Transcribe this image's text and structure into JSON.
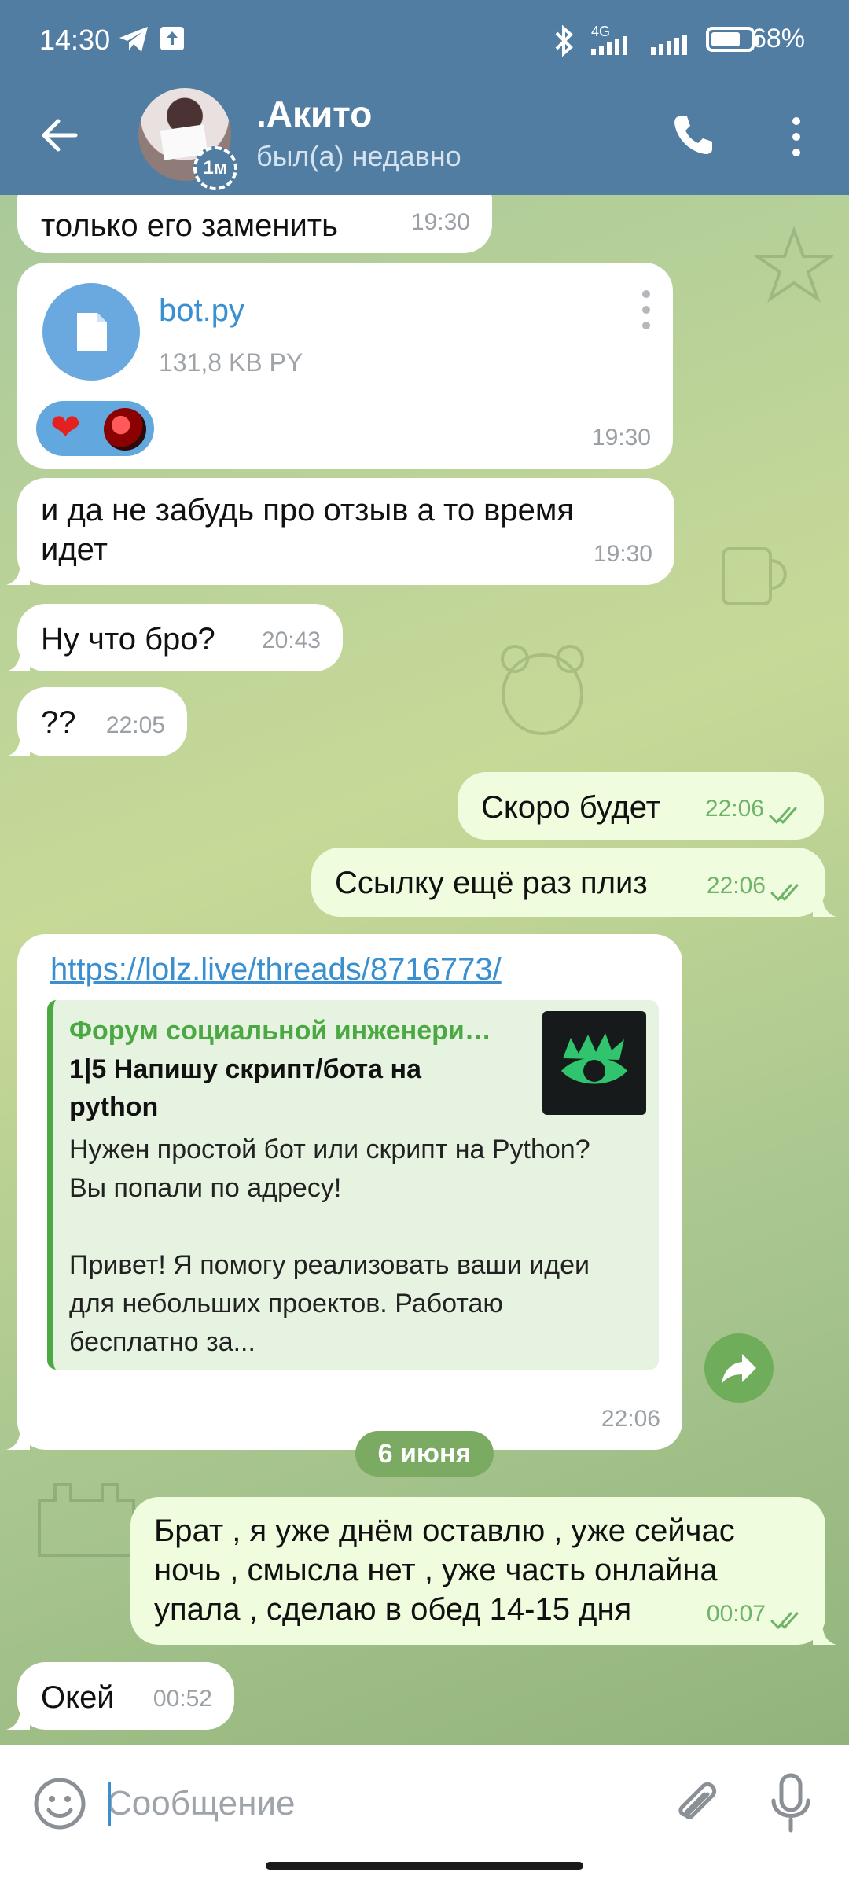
{
  "status_bar": {
    "time": "14:30",
    "network": "4G",
    "battery": "68%"
  },
  "header": {
    "title": ".Акито",
    "status": "был(а) недавно",
    "story_badge": "1м"
  },
  "messages": [
    {
      "dir": "in",
      "text": "только его заменить",
      "time": "19:30"
    },
    {
      "dir": "in",
      "type": "file",
      "file_name": "bot.py",
      "file_size": "131,8 KB PY",
      "reaction": "❤",
      "time": "19:30"
    },
    {
      "dir": "in",
      "text": "и да не забудь про отзыв а то время\nидет",
      "time": "19:30"
    },
    {
      "dir": "in",
      "text": "Ну что бро?",
      "time": "20:43"
    },
    {
      "dir": "in",
      "text": "??",
      "time": "22:05"
    },
    {
      "dir": "out",
      "text": "Скоро будет",
      "time": "22:06"
    },
    {
      "dir": "out",
      "text": "Ссылку ещё раз плиз",
      "time": "22:06"
    },
    {
      "dir": "in",
      "type": "link",
      "url": "https://lolz.live/threads/8716773/",
      "preview_site": "Форум социальной инженери…",
      "preview_title": "1|5 Напишу скрипт/бота на python",
      "preview_desc": "Нужен простой бот или скрипт на Python? Вы попали по адресу!\n\nПривет! Я помогу реализовать ваши идеи для небольших проектов. Работаю бесплатно за...",
      "time": "22:06"
    },
    {
      "type": "date",
      "text": "6 июня"
    },
    {
      "dir": "out",
      "text": "Брат , я уже днём оставлю , уже сейчас\nночь , смысла нет , уже часть онлайна\nупала , сделаю в обед 14-15 дня",
      "time": "00:07"
    },
    {
      "dir": "in",
      "text": "Окей",
      "time": "00:52"
    }
  ],
  "input": {
    "placeholder": "Сообщение"
  },
  "colors": {
    "header_bg": "#517da2",
    "outgoing_bubble": "#effdde",
    "incoming_bubble": "#ffffff",
    "link": "#3a8fd0",
    "accent_green": "#4ca843"
  },
  "icons": [
    "back-arrow-icon",
    "phone-icon",
    "more-vertical-icon",
    "file-icon",
    "share-icon",
    "emoji-icon",
    "attach-icon",
    "mic-icon"
  ]
}
